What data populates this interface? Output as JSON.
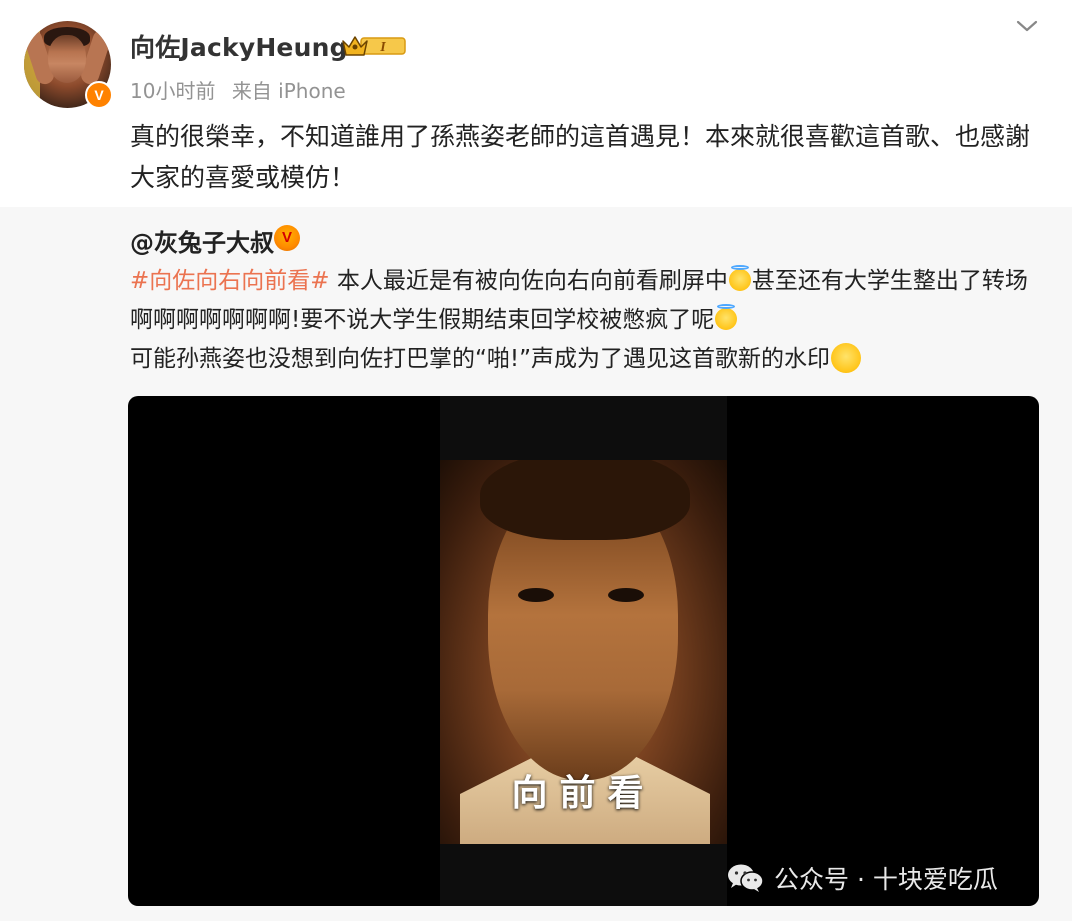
{
  "post": {
    "username": "向佐JackyHeung",
    "level_badge": "I",
    "meta": {
      "time": "10小时前",
      "source": "来自 iPhone"
    },
    "text": "真的很榮幸，不知道誰用了孫燕姿老師的這首遇見！本來就很喜歡這首歌、也感謝大家的喜愛或模仿！"
  },
  "repost": {
    "author": "@灰兔子大叔",
    "hashtag": "#向佐向右向前看#",
    "line1_rest": " 本人最近是有被向佐向右向前看刷屏中",
    "line1_tail": "甚至还有大学生整出了转场",
    "line2": "啊啊啊啊啊啊啊!要不说大学生假期结束回学校被憋疯了呢",
    "line3": "可能孙燕姿也没想到向佐打巴掌的“啪!”声成为了遇见这首歌新的水印"
  },
  "video": {
    "subtitle": "向前看"
  },
  "watermark": {
    "text": "公众号 · 十块爱吃瓜"
  },
  "colors": {
    "hashtag": "#eb7350",
    "verified": "#ff8200",
    "meta": "#939393",
    "repost_bg": "#f7f7f7"
  },
  "icons": {
    "verified": "verified-v-icon",
    "crown": "crown-level-badge",
    "menu": "chevron-down-icon",
    "emoji_halo": "angel-emoji",
    "emoji_laugh": "laugh-cry-emoji",
    "wechat": "wechat-icon"
  }
}
